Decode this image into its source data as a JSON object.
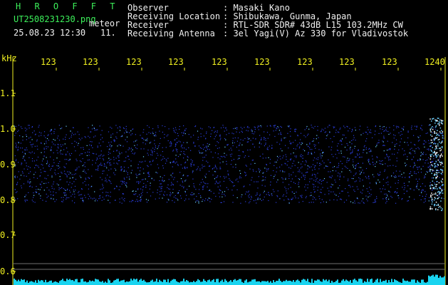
{
  "header": {
    "brand": "H R O F F T",
    "filename": "UT2508231230.png",
    "mode": "meteor",
    "datetime": "25.08.23 12:30",
    "count": "11.",
    "fields": [
      {
        "label": "Observer",
        "value": ": Masaki Kano"
      },
      {
        "label": "Receiving Location",
        "value": ": Shibukawa, Gunma, Japan"
      },
      {
        "label": "Receiver",
        "value": ": RTL-SDR SDR# 43dB L15 103.2MHz CW"
      },
      {
        "label": "Receiving Antenna",
        "value": ": 3el Yagi(V) Az 330 for Vladivostok"
      }
    ]
  },
  "time_axis": {
    "labels": [
      "123",
      "123",
      "123",
      "123",
      "123",
      "123",
      "123",
      "123",
      "123",
      "1240"
    ]
  },
  "freq_axis": {
    "unit": "kHz",
    "ticks": [
      "1.1",
      "1.0",
      "0.9",
      "0.8",
      "0.7",
      "0.6"
    ]
  },
  "colors": {
    "background": "#000000",
    "green_text": "#3cf05a",
    "white_text": "#f0f0f0",
    "yellow_text": "#f0f020",
    "noise": "#2a3cd8",
    "noise_bright": "#6ad0ff",
    "meteor": "#ffffff",
    "power_bar": "#19d4f0"
  }
}
